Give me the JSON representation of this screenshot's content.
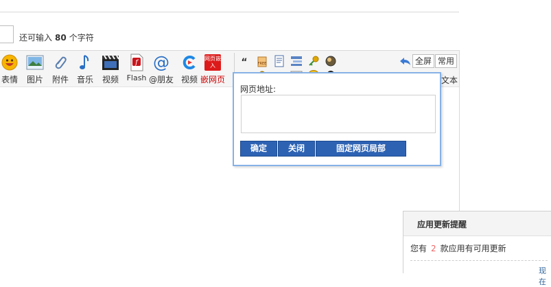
{
  "counter": {
    "prefix": "还可输入",
    "count": "80",
    "suffix": "个字符"
  },
  "toolbar": {
    "items": [
      {
        "label": "表情",
        "icon": "smiley-icon"
      },
      {
        "label": "图片",
        "icon": "image-icon"
      },
      {
        "label": "附件",
        "icon": "paperclip-icon"
      },
      {
        "label": "音乐",
        "icon": "music-note-icon"
      },
      {
        "label": "视频",
        "icon": "video-clapper-icon"
      },
      {
        "label": "Flash",
        "icon": "flash-icon"
      },
      {
        "label": "@朋友",
        "icon": "at-icon"
      },
      {
        "label": "视频",
        "icon": "video-c-icon"
      },
      {
        "label": "嵌网页",
        "icon": "embed-webpage-icon",
        "icon_text": "网页嵌入"
      }
    ],
    "quote_glyph": "“",
    "code_glyph": "<>",
    "fullscreen_label": "全屏",
    "common_label": "常用",
    "partial_text": "文本"
  },
  "popup": {
    "label": "网页地址:",
    "input_value": "",
    "confirm_label": "确定",
    "close_label": "关闭",
    "fix_label": "固定网页局部"
  },
  "notify": {
    "title": "应用更新提醒",
    "body_prefix": "您有",
    "count": "2",
    "body_suffix": "款应用有可用更新",
    "link_partial": "现在"
  },
  "colors": {
    "accent_blue": "#2d62b3",
    "popup_border": "#86b1e6",
    "embed_red": "#dd1a1a"
  }
}
